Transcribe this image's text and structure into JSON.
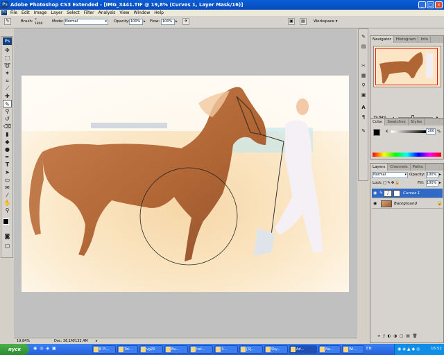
{
  "window": {
    "title": "Adobe Photoshop CS3 Extended - [IMG_3441.TIF @ 19,8% (Curves 1, Layer Mask/16)]",
    "app_badge": "Ps"
  },
  "menu": [
    "File",
    "Edit",
    "Image",
    "Layer",
    "Select",
    "Filter",
    "Analysis",
    "View",
    "Window",
    "Help"
  ],
  "options": {
    "brush_label": "Brush:",
    "brush_size": "1800",
    "mode_label": "Mode:",
    "mode_value": "Normal",
    "opacity_label": "Opacity:",
    "opacity_value": "100%",
    "flow_label": "Flow:",
    "flow_value": "100%",
    "workspace_label": "Workspace"
  },
  "status": {
    "zoom": "19,84%",
    "doc": "Doc: 36,1M/132,4M"
  },
  "navigator": {
    "tabs": [
      "Navigator",
      "Histogram",
      "Info"
    ],
    "zoom": "19,84%"
  },
  "color_panel": {
    "tabs": [
      "Color",
      "Swatches",
      "Styles"
    ],
    "channel_label": "K",
    "channel_value": "100",
    "unit": "%"
  },
  "layers_panel": {
    "tabs": [
      "Layers",
      "Channels",
      "Paths"
    ],
    "blend_mode": "Normal",
    "opacity_label": "Opacity:",
    "opacity_value": "100%",
    "lock_label": "Lock:",
    "fill_label": "Fill:",
    "fill_value": "100%",
    "layers": [
      {
        "name": "Curves 1",
        "selected": true
      },
      {
        "name": "Background",
        "selected": false
      }
    ]
  },
  "taskbar": {
    "start_label": "пуск",
    "items": [
      "В Pi...",
      "Tot...",
      "vg20",
      "Bu...",
      "hel...",
      "3...",
      "[S]...",
      "Sky...",
      "Ad...",
      "Na...",
      "Wi..."
    ],
    "active_index": 8,
    "lang": "EN",
    "clock": "16:52"
  },
  "colors": {
    "titlebar": "#0a5fd8",
    "selected_layer": "#316ac5",
    "taskbar": "#245edb",
    "start": "#2d8b2d"
  }
}
